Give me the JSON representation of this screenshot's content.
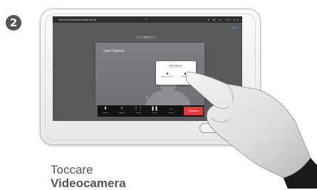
{
  "step": {
    "number": "2"
  },
  "status_bar": {
    "user": "bennhard.johansson@mfs.sp",
    "center_icon": "home-icon",
    "icons": "♦ ✉ ▭ 10:14"
  },
  "screen": {
    "badge": "00:56",
    "pill": "Jane ▾"
  },
  "video": {
    "participant_name": "Jane Dawson"
  },
  "popup": {
    "name": "Jane Dawson",
    "address": "jane.dawson@mfs.sp",
    "actions": [
      {
        "icon": "star-icon",
        "glyph": "★",
        "label": "Aggiungi a preferiti"
      },
      {
        "icon": "video-camera-icon",
        "glyph": "■",
        "label": "Videocamera"
      }
    ]
  },
  "toolbar": {
    "buttons": [
      {
        "icon": "share-icon",
        "glyph": "⬆",
        "label": "Condividi"
      },
      {
        "icon": "add-icon",
        "glyph": "+",
        "label": "Aggiungi"
      },
      {
        "icon": "keypad-icon",
        "glyph": "⋮⋮",
        "label": "Tastierino"
      },
      {
        "icon": "hold-icon",
        "glyph": "❚❚",
        "label": "In attesa"
      },
      {
        "icon": "transfer-icon",
        "glyph": "→",
        "label": "Trasferisci"
      }
    ],
    "end_label": "Termina"
  },
  "caption": {
    "line1": "Toccare",
    "line2": "Videocamera"
  },
  "colors": {
    "end_button": "#e23b3f",
    "screen_bg": "#58595b",
    "toolbar_bg": "#141414"
  }
}
